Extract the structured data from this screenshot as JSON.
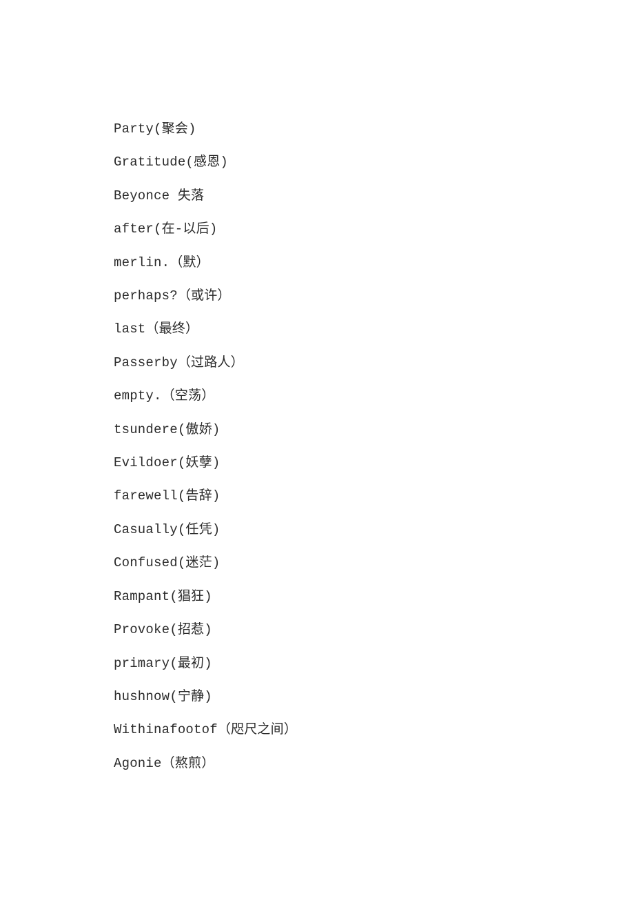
{
  "document": {
    "page_background": "#ffffff",
    "text_color": "#2b2b2b",
    "lines": [
      {
        "text": "Party(聚会)"
      },
      {
        "text": "Gratitude(感恩)"
      },
      {
        "text": "Beyonce 失落"
      },
      {
        "text": "after(在-以后)"
      },
      {
        "text": "merlin.（默）"
      },
      {
        "text": "perhaps?（或许）"
      },
      {
        "text": "last（最终）"
      },
      {
        "text": "Passerby（过路人）"
      },
      {
        "text": "empty.（空荡）"
      },
      {
        "text": "tsundere(傲娇)"
      },
      {
        "text": "Evildoer(妖孽)"
      },
      {
        "text": "farewell(告辞)"
      },
      {
        "text": "Casually(任凭)"
      },
      {
        "text": "Confused(迷茫)"
      },
      {
        "text": "Rampant(猖狂)"
      },
      {
        "text": "Provoke(招惹)"
      },
      {
        "text": "primary(最初)"
      },
      {
        "text": "hushnow(宁静)"
      },
      {
        "text": "Withinafootof（咫尺之间）"
      },
      {
        "text": "Agonie（熬煎）"
      }
    ]
  }
}
